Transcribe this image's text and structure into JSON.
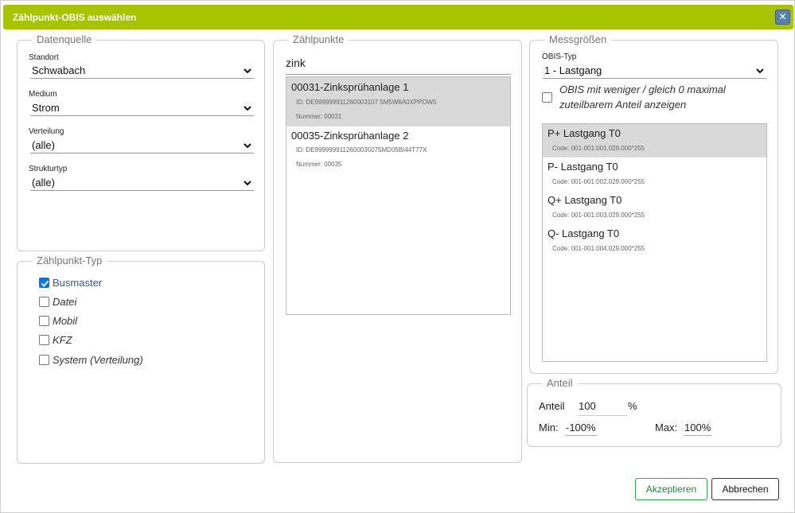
{
  "dialog": {
    "title": "Zählpunkt-OBIS auswählen",
    "close_symbol": "✕"
  },
  "datenquelle": {
    "legend": "Datenquelle",
    "fields": [
      {
        "label": "Standort",
        "value": "Schwabach"
      },
      {
        "label": "Medium",
        "value": "Strom"
      },
      {
        "label": "Verteilung",
        "value": "(alle)"
      },
      {
        "label": "Strukturtyp",
        "value": "(alle)"
      }
    ]
  },
  "zaehlpunkttyp": {
    "legend": "Zählpunkt-Typ",
    "options": [
      {
        "label": "Busmaster",
        "checked": true
      },
      {
        "label": "Datei",
        "checked": false
      },
      {
        "label": "Mobil",
        "checked": false
      },
      {
        "label": "KFZ",
        "checked": false
      },
      {
        "label": "System (Verteilung)",
        "checked": false
      }
    ]
  },
  "zaehlpunkte": {
    "legend": "Zählpunkte",
    "search_value": "zink",
    "items": [
      {
        "name": "00031-Zinksprühanlage 1",
        "id": "ID: DE999999911260003107 5M5W6A0XPPDW5",
        "nummer": "Nummer: 00031",
        "selected": true
      },
      {
        "name": "00035-Zinksprühanlage 2",
        "id": "ID: DE9999999112600035075MD05BI44T77X",
        "nummer": "Nummer: 00035",
        "selected": false
      }
    ]
  },
  "messgroessen": {
    "legend": "Messgrößen",
    "obis_label": "OBIS-Typ",
    "obis_value": "1 - Lastgang",
    "checkbox_label_line1": "OBIS mit weniger / gleich 0 maximal",
    "checkbox_label_line2": "zuteilbarem Anteil anzeigen",
    "items": [
      {
        "name": "P+ Lastgang T0",
        "code": "Code: 001-001:001.029.000*255",
        "selected": true
      },
      {
        "name": "P- Lastgang T0",
        "code": "Code: 001-001:002.029.000*255",
        "selected": false
      },
      {
        "name": "Q+ Lastgang T0",
        "code": "Code: 001-001:003.029.000*255",
        "selected": false
      },
      {
        "name": "Q- Lastgang T0",
        "code": "Code: 001-001:004.029.000*255",
        "selected": false
      }
    ]
  },
  "anteil": {
    "legend": "Anteil",
    "label": "Anteil",
    "value": "100",
    "unit": "%",
    "min_label": "Min:",
    "min_value": "-100%",
    "max_label": "Max:",
    "max_value": "100%"
  },
  "buttons": {
    "accept": "Akzeptieren",
    "cancel": "Abbrechen"
  }
}
